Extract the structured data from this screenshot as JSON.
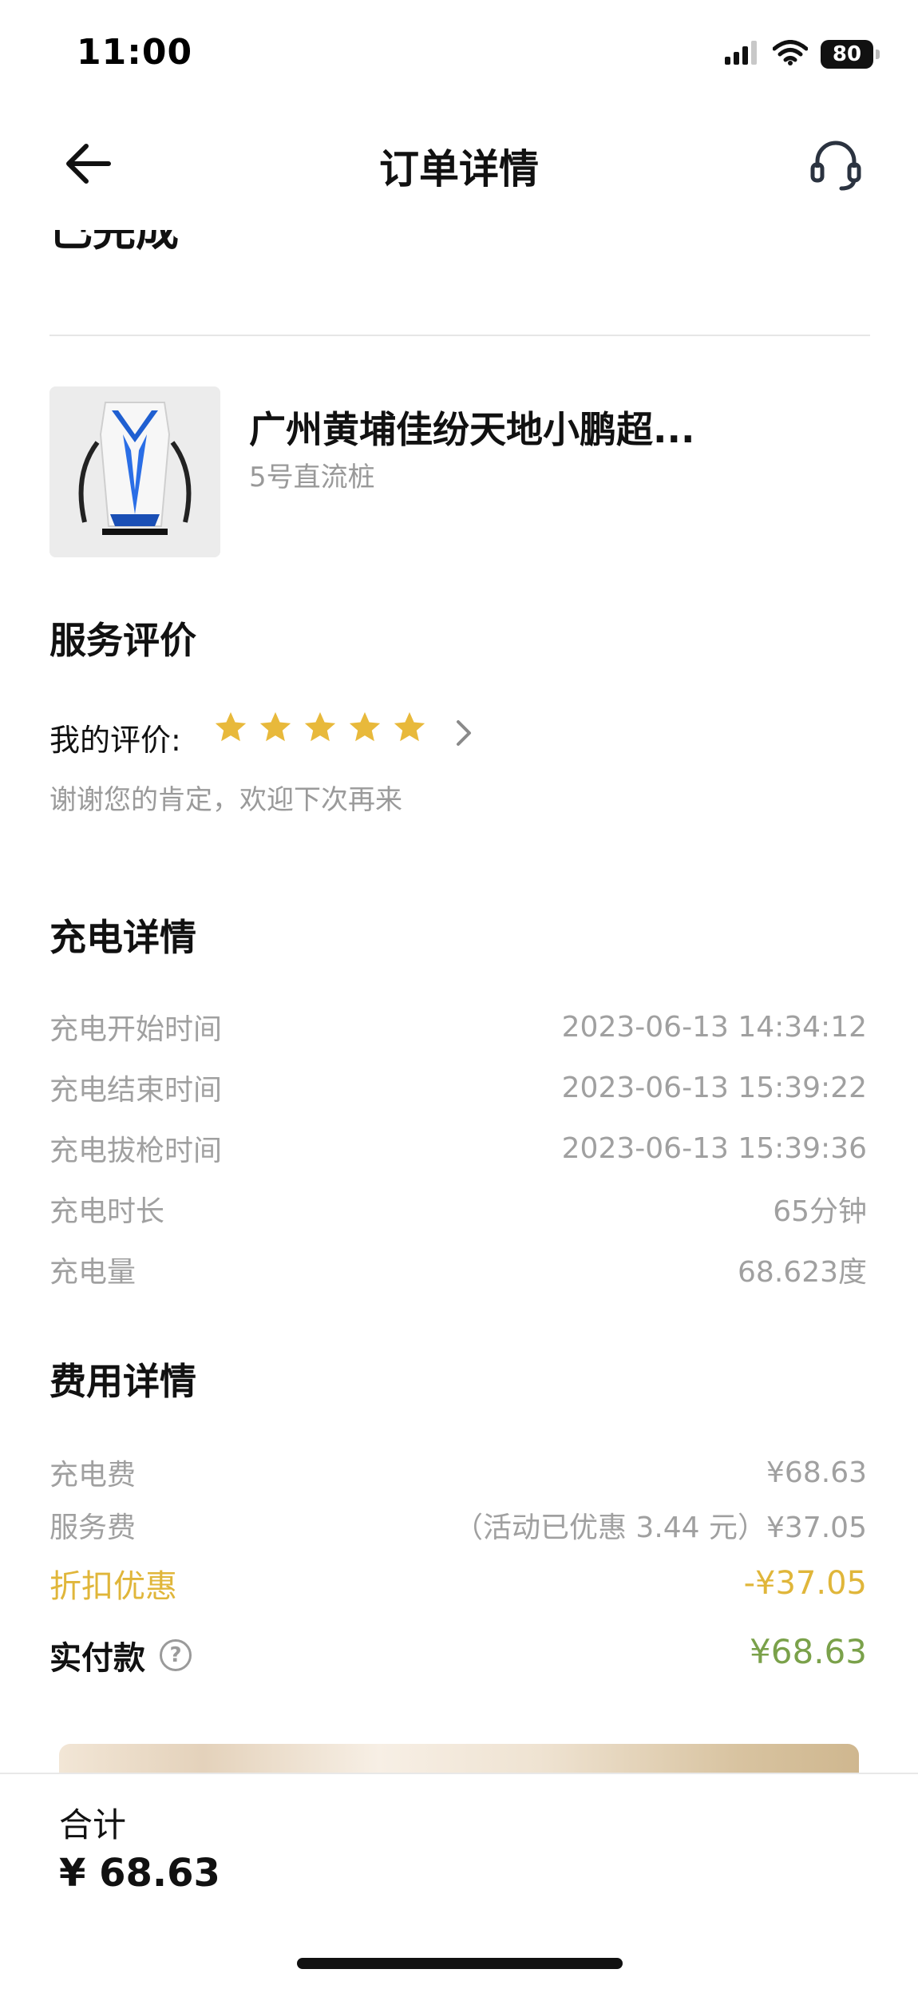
{
  "status_bar": {
    "time": "11:00",
    "battery": "80"
  },
  "header": {
    "title": "订单详情",
    "back_icon": "arrow-left-icon",
    "service_icon": "headset-icon"
  },
  "order_status": "已完成",
  "station": {
    "name": "广州黄埔佳纷天地小鹏超...",
    "charger": "5号直流桩"
  },
  "review": {
    "section_title": "服务评价",
    "label": "我的评价:",
    "stars": 5,
    "max_stars": 5,
    "star_color": "#E8B93B",
    "comment": "谢谢您的肯定，欢迎下次再来"
  },
  "charging": {
    "section_title": "充电详情",
    "rows": [
      {
        "label": "充电开始时间",
        "value": "2023-06-13 14:34:12"
      },
      {
        "label": "充电结束时间",
        "value": "2023-06-13 15:39:22"
      },
      {
        "label": "充电拔枪时间",
        "value": "2023-06-13 15:39:36"
      },
      {
        "label": "充电时长",
        "value": "65分钟"
      },
      {
        "label": "充电量",
        "value": "68.623度"
      }
    ]
  },
  "fees": {
    "section_title": "费用详情",
    "charge_fee": {
      "label": "充电费",
      "value": "¥68.63"
    },
    "service_fee": {
      "label": "服务费",
      "value": "（活动已优惠 3.44 元）¥37.05"
    },
    "discount": {
      "label": "折扣优惠",
      "value": "-¥37.05",
      "color": "#E0B63A"
    },
    "paid": {
      "label": "实付款",
      "value": "¥68.63",
      "color": "#7AA14A"
    }
  },
  "bottom_bar": {
    "total_label": "合计",
    "total_value": "¥ 68.63"
  }
}
